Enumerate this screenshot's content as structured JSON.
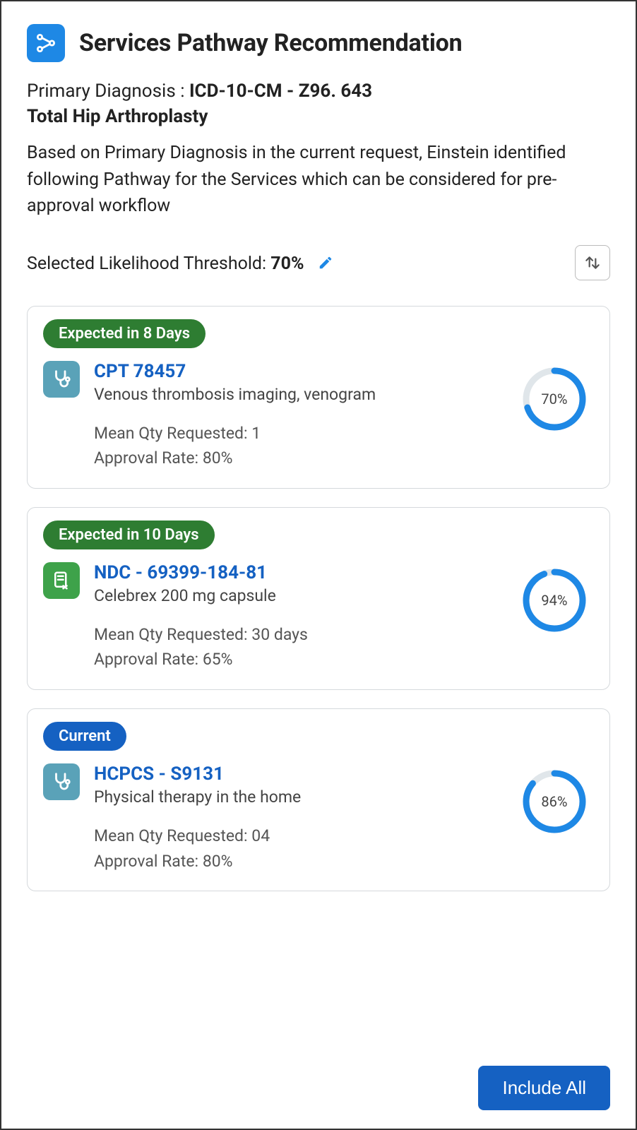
{
  "header": {
    "title": "Services Pathway Recommendation"
  },
  "diagnosis": {
    "label": "Primary Diagnosis :",
    "code": "ICD-10-CM - Z96. 643",
    "name": "Total Hip Arthroplasty"
  },
  "intro": "Based on Primary Diagnosis in the current request, Einstein identified following Pathway for the Services which can be considered for pre-approval workflow",
  "threshold": {
    "label": "Selected Likelihood Threshold: ",
    "value": "70%"
  },
  "cards": [
    {
      "pill": "Expected in 8 Days",
      "pillColor": "green",
      "iconColor": "teal",
      "iconType": "stethoscope",
      "code": "CPT 78457",
      "desc": "Venous thrombosis imaging, venogram",
      "qtyLabel": "Mean Qty Requested: 1",
      "approvalLabel": "Approval Rate: 80%",
      "donutPercent": 70,
      "donutLabel": "70%"
    },
    {
      "pill": "Expected in 10 Days",
      "pillColor": "green",
      "iconColor": "green",
      "iconType": "rx",
      "code": "NDC - 69399-184-81",
      "desc": "Celebrex 200 mg capsule",
      "qtyLabel": "Mean Qty Requested: 30 days",
      "approvalLabel": "Approval Rate: 65%",
      "donutPercent": 94,
      "donutLabel": "94%"
    },
    {
      "pill": "Current",
      "pillColor": "blue",
      "iconColor": "teal",
      "iconType": "stethoscope",
      "code": "HCPCS - S9131",
      "desc": "Physical therapy in the home",
      "qtyLabel": "Mean Qty Requested: 04",
      "approvalLabel": "Approval Rate: 80%",
      "donutPercent": 86,
      "donutLabel": "86%"
    }
  ],
  "actions": {
    "includeAll": "Include All"
  }
}
